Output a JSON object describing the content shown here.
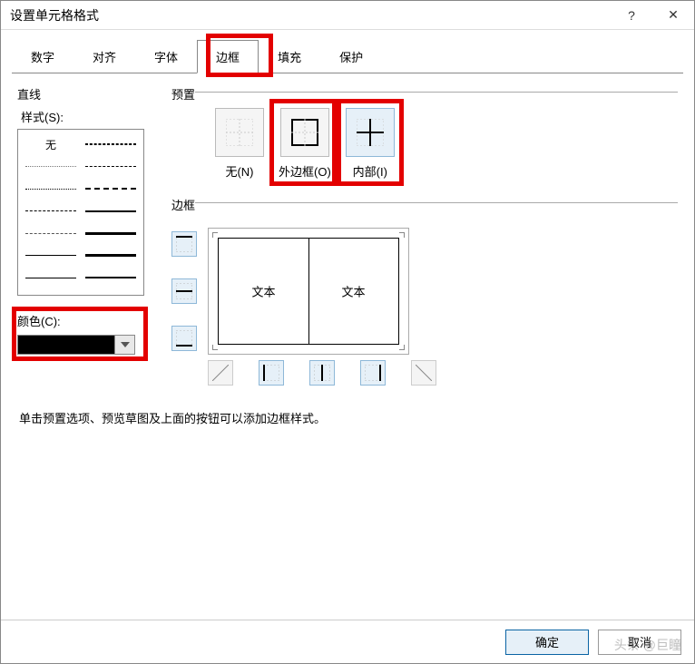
{
  "window": {
    "title": "设置单元格格式",
    "help": "?",
    "close": "✕"
  },
  "tabs": {
    "number": "数字",
    "alignment": "对齐",
    "font": "字体",
    "border": "边框",
    "fill": "填充",
    "protection": "保护",
    "active": "border"
  },
  "left": {
    "line_group": "直线",
    "style_label": "样式(S):",
    "none_label": "无",
    "color_label": "颜色(C):",
    "color_value": "#000000"
  },
  "presets": {
    "group": "预置",
    "none": "无(N)",
    "outline": "外边框(O)",
    "inside": "内部(I)"
  },
  "border": {
    "group": "边框",
    "sample_text": "文本"
  },
  "hint": "单击预置选项、预览草图及上面的按钮可以添加边框样式。",
  "footer": {
    "ok": "确定",
    "cancel": "取消"
  },
  "watermark": "头条 @巨瞳",
  "highlights": {
    "tab_border": true,
    "preset_outline": true,
    "preset_inside": true,
    "color_picker": true
  }
}
